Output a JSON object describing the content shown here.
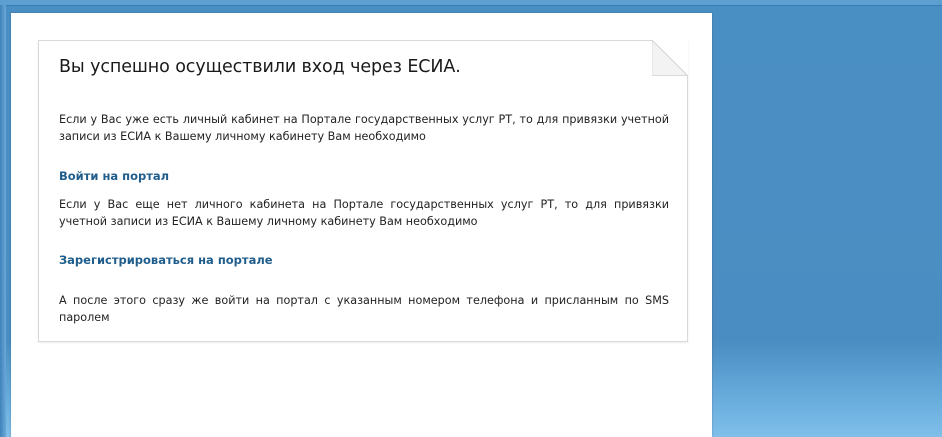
{
  "card": {
    "title": "Вы успешно осуществили вход через ЕСИА.",
    "paragraph_existing": "Если у Вас уже есть личный кабинет на Портале государственных услуг РТ, то для привязки учетной записи из ЕСИА к Вашему личному кабинету Вам необходимо",
    "login_link": "Войти на портал",
    "paragraph_new": "Если у Вас еще нет личного кабинета на Портале государственных услуг РТ, то для привязки учетной записи из ЕСИА к Вашему личному кабинету Вам необходимо",
    "register_link": "Зарегистрироваться на портале",
    "paragraph_after": "А после этого сразу же войти на портал с указанным номером телефона и присланным по SMS паролем"
  },
  "colors": {
    "link": "#1f5d8c",
    "background_blue": "#4a8dc2",
    "card_border": "#d9d9d9"
  }
}
